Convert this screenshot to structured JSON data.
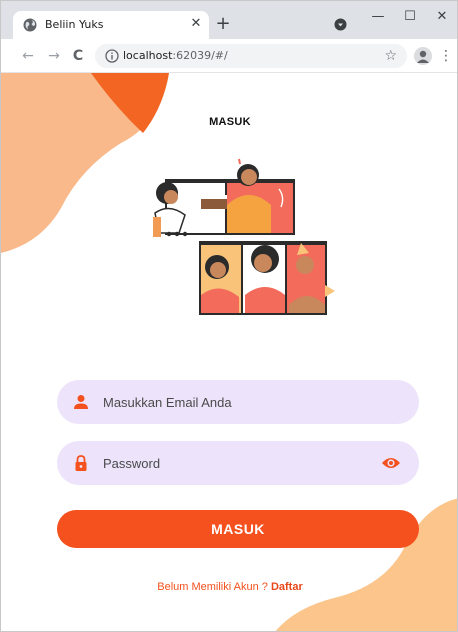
{
  "browser": {
    "tab_title": "Beliin Yuks",
    "tab_close": "✕",
    "new_tab": "+",
    "url_host": "localhost",
    "url_rest": ":62039/#/",
    "star": "☆",
    "menu": "⋮",
    "window_controls": {
      "minimize": "—",
      "maximize": "☐",
      "close": "✕"
    },
    "nav": {
      "back": "←",
      "forward": "→",
      "reload": "C"
    }
  },
  "page": {
    "title": "MASUK"
  },
  "form": {
    "email_placeholder": "Masukkan Email Anda",
    "password_placeholder": "Password",
    "submit_label": "MASUK"
  },
  "footer": {
    "prompt": "Belum Memiliki Akun ? ",
    "link": "Daftar"
  },
  "colors": {
    "accent": "#f4511e",
    "field_bg": "#ede3fb",
    "blob_light": "#f9b98a",
    "blob_dark": "#f26522",
    "blob_bottom": "#fbc58c"
  },
  "icons": {
    "email_field": "person-icon",
    "password_field": "lock-icon",
    "password_toggle": "eye-icon"
  }
}
